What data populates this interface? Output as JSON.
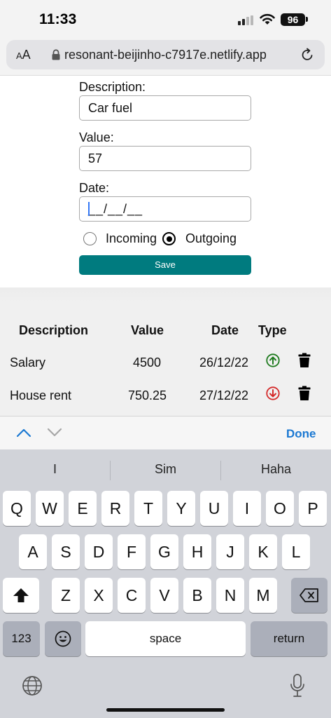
{
  "status_bar": {
    "time": "11:33",
    "battery": "96"
  },
  "browser": {
    "text_size_label_small": "A",
    "text_size_label_large": "A",
    "url": "resonant-beijinho-c7917e.netlify.app"
  },
  "form": {
    "description_label": "Description:",
    "description_value": "Car fuel",
    "value_label": "Value:",
    "value_value": "57",
    "date_label": "Date:",
    "date_value": "__/__/__",
    "radio_incoming": "Incoming",
    "radio_outgoing": "Outgoing",
    "selected_type": "Outgoing",
    "save_label": "Save",
    "accent_color": "#007b7f"
  },
  "table": {
    "headers": [
      "Description",
      "Value",
      "Date",
      "Type"
    ],
    "rows": [
      {
        "description": "Salary",
        "value": "4500",
        "date": "26/12/22",
        "type": "incoming",
        "type_icon": "arrow-up-circle-icon",
        "type_color": "#1e7a1e"
      },
      {
        "description": "House rent",
        "value": "750.25",
        "date": "27/12/22",
        "type": "outgoing",
        "type_icon": "arrow-down-circle-icon",
        "type_color": "#d42a2a"
      }
    ]
  },
  "keyboard_accessory": {
    "done_label": "Done",
    "done_color": "#1a78d2"
  },
  "keyboard": {
    "suggestions": [
      "I",
      "Sim",
      "Haha"
    ],
    "row1": [
      "Q",
      "W",
      "E",
      "R",
      "T",
      "Y",
      "U",
      "I",
      "O",
      "P"
    ],
    "row2": [
      "A",
      "S",
      "D",
      "F",
      "G",
      "H",
      "J",
      "K",
      "L"
    ],
    "row3": [
      "Z",
      "X",
      "C",
      "V",
      "B",
      "N",
      "M"
    ],
    "numbers_label": "123",
    "space_label": "space",
    "return_label": "return"
  }
}
